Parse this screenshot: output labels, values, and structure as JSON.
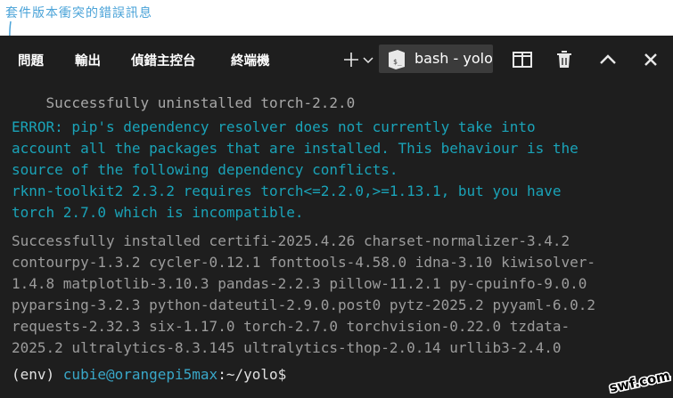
{
  "annotation": {
    "text": "套件版本衝突的錯誤訊息"
  },
  "tabs": [
    {
      "label": "問題"
    },
    {
      "label": "輸出"
    },
    {
      "label": "偵錯主控台"
    },
    {
      "label": "終端機"
    }
  ],
  "toolbar": {
    "add_icon": "plus-icon",
    "dropdown_icon": "chevron-down-icon",
    "profile_label": "bash - yolo",
    "profile_icon": "terminal-icon",
    "split_icon": "split-icon",
    "trash_icon": "trash-icon",
    "maximize_icon": "chevron-up-icon",
    "close_icon": "close-icon"
  },
  "terminal": {
    "lines": [
      "    Successfully uninstalled torch-2.2.0",
      "ERROR: pip's dependency resolver does not currently take into",
      "account all the packages that are installed. This behaviour is the",
      "source of the following dependency conflicts.",
      "rknn-toolkit2 2.3.2 requires torch<=2.2.0,>=1.13.1, but you have",
      "torch 2.7.0 which is incompatible.",
      "Successfully installed certifi-2025.4.26 charset-normalizer-3.4.2",
      "contourpy-1.3.2 cycler-0.12.1 fonttools-4.58.0 idna-3.10 kiwisolver-",
      "1.4.8 matplotlib-3.10.3 pandas-2.2.3 pillow-11.2.1 py-cpuinfo-9.0.0",
      "pyparsing-3.2.3 python-dateutil-2.9.0.post0 pytz-2025.2 pyyaml-6.0.2",
      "requests-2.32.3 six-1.17.0 torch-2.7.0 torchvision-0.22.0 tzdata-",
      "2025.2 ultralytics-8.3.145 ultralytics-thop-2.0.14 urllib3-2.4.0"
    ],
    "prompt": {
      "env": "(env) ",
      "userhost": "cubie@orangepi5max",
      "path": ":~/yolo$"
    }
  },
  "watermark": {
    "text": "swf.com.tw"
  },
  "colors": {
    "background": "#1e1e1e",
    "error_text": "#1aa3b8",
    "normal_text": "#a8a8a8",
    "prompt_user": "#39a7c8",
    "annotation": "#4aa3d8"
  }
}
